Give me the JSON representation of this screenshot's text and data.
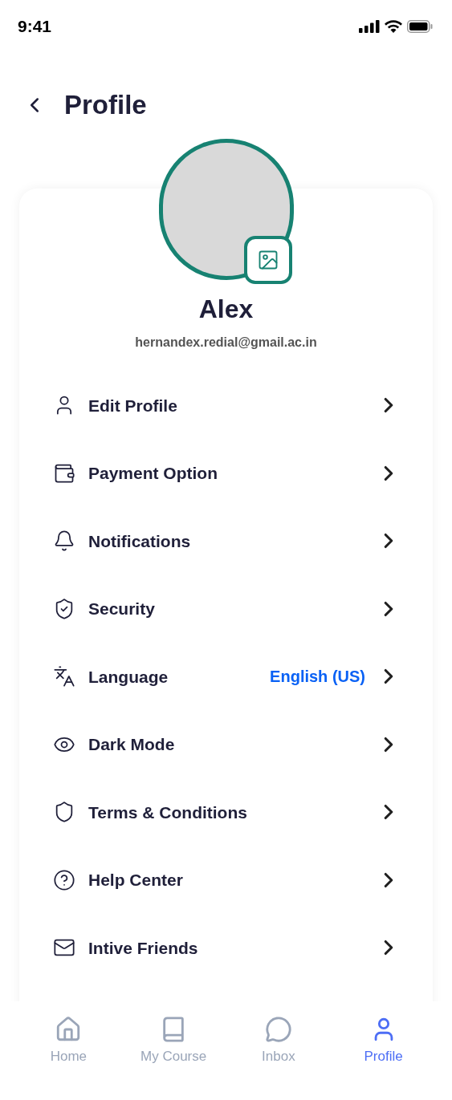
{
  "status_bar": {
    "time": "9:41"
  },
  "header": {
    "title": "Profile"
  },
  "profile": {
    "name": "Alex",
    "email": "hernandex.redial@gmail.ac.in"
  },
  "menu": [
    {
      "label": "Edit Profile"
    },
    {
      "label": "Payment Option"
    },
    {
      "label": "Notifications"
    },
    {
      "label": "Security"
    },
    {
      "label": "Language",
      "value": "English (US)"
    },
    {
      "label": "Dark Mode"
    },
    {
      "label": "Terms & Conditions"
    },
    {
      "label": "Help Center"
    },
    {
      "label": "Intive Friends"
    }
  ],
  "nav": [
    {
      "label": "Home",
      "selected": false
    },
    {
      "label": "My Course",
      "selected": false
    },
    {
      "label": "Inbox",
      "selected": false
    },
    {
      "label": "Profile",
      "selected": true
    }
  ]
}
